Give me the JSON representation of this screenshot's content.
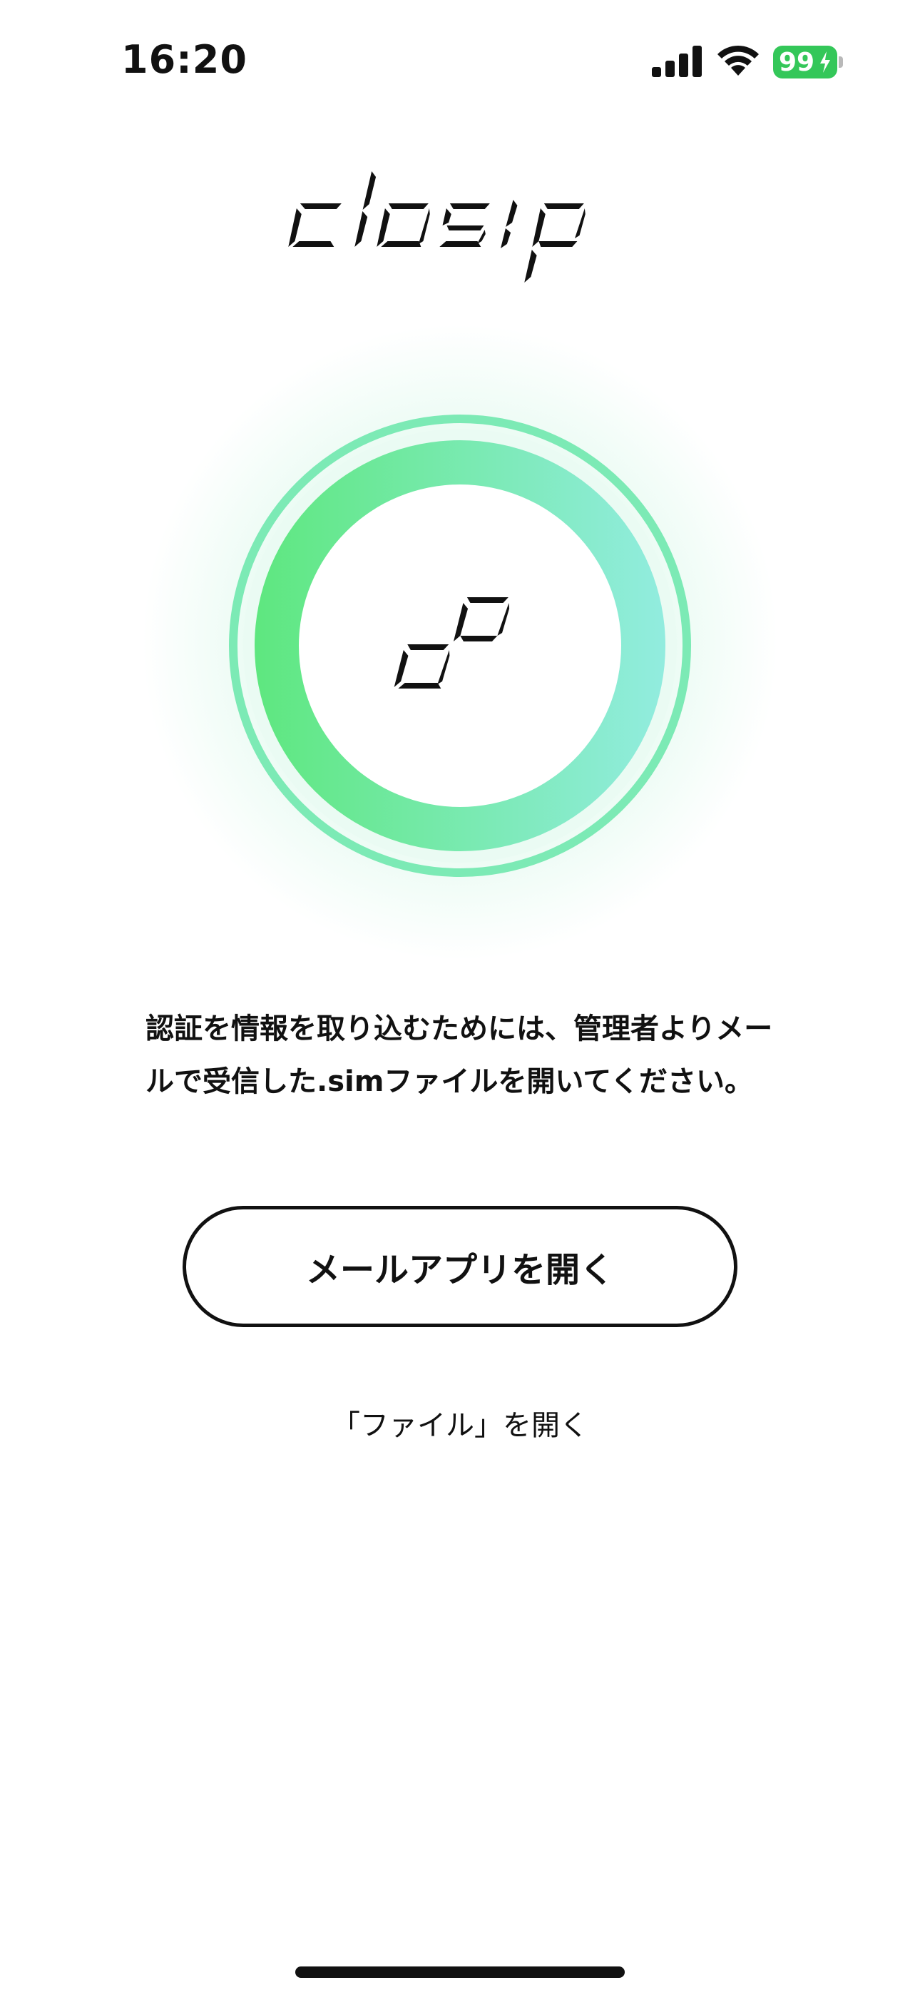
{
  "status_bar": {
    "time": "16:20",
    "battery_level": "99",
    "battery_color": "#34c759",
    "icons": [
      "signal-icon",
      "wifi-icon",
      "battery-icon",
      "charging-bolt-icon"
    ]
  },
  "logo": {
    "text": "closip",
    "icon": "closip-logo"
  },
  "hero": {
    "icon": "closip-link-icon",
    "ring_gradient": [
      "#5ee77f",
      "#92ecdf"
    ],
    "outer_ring_color": "#7ceab5"
  },
  "description": "認証を情報を取り込むためには、管理者よりメールで受信した.simファイルを開いてください。",
  "buttons": {
    "open_mail_label": "メールアプリを開く",
    "open_files_label": "「ファイル」を開く"
  }
}
